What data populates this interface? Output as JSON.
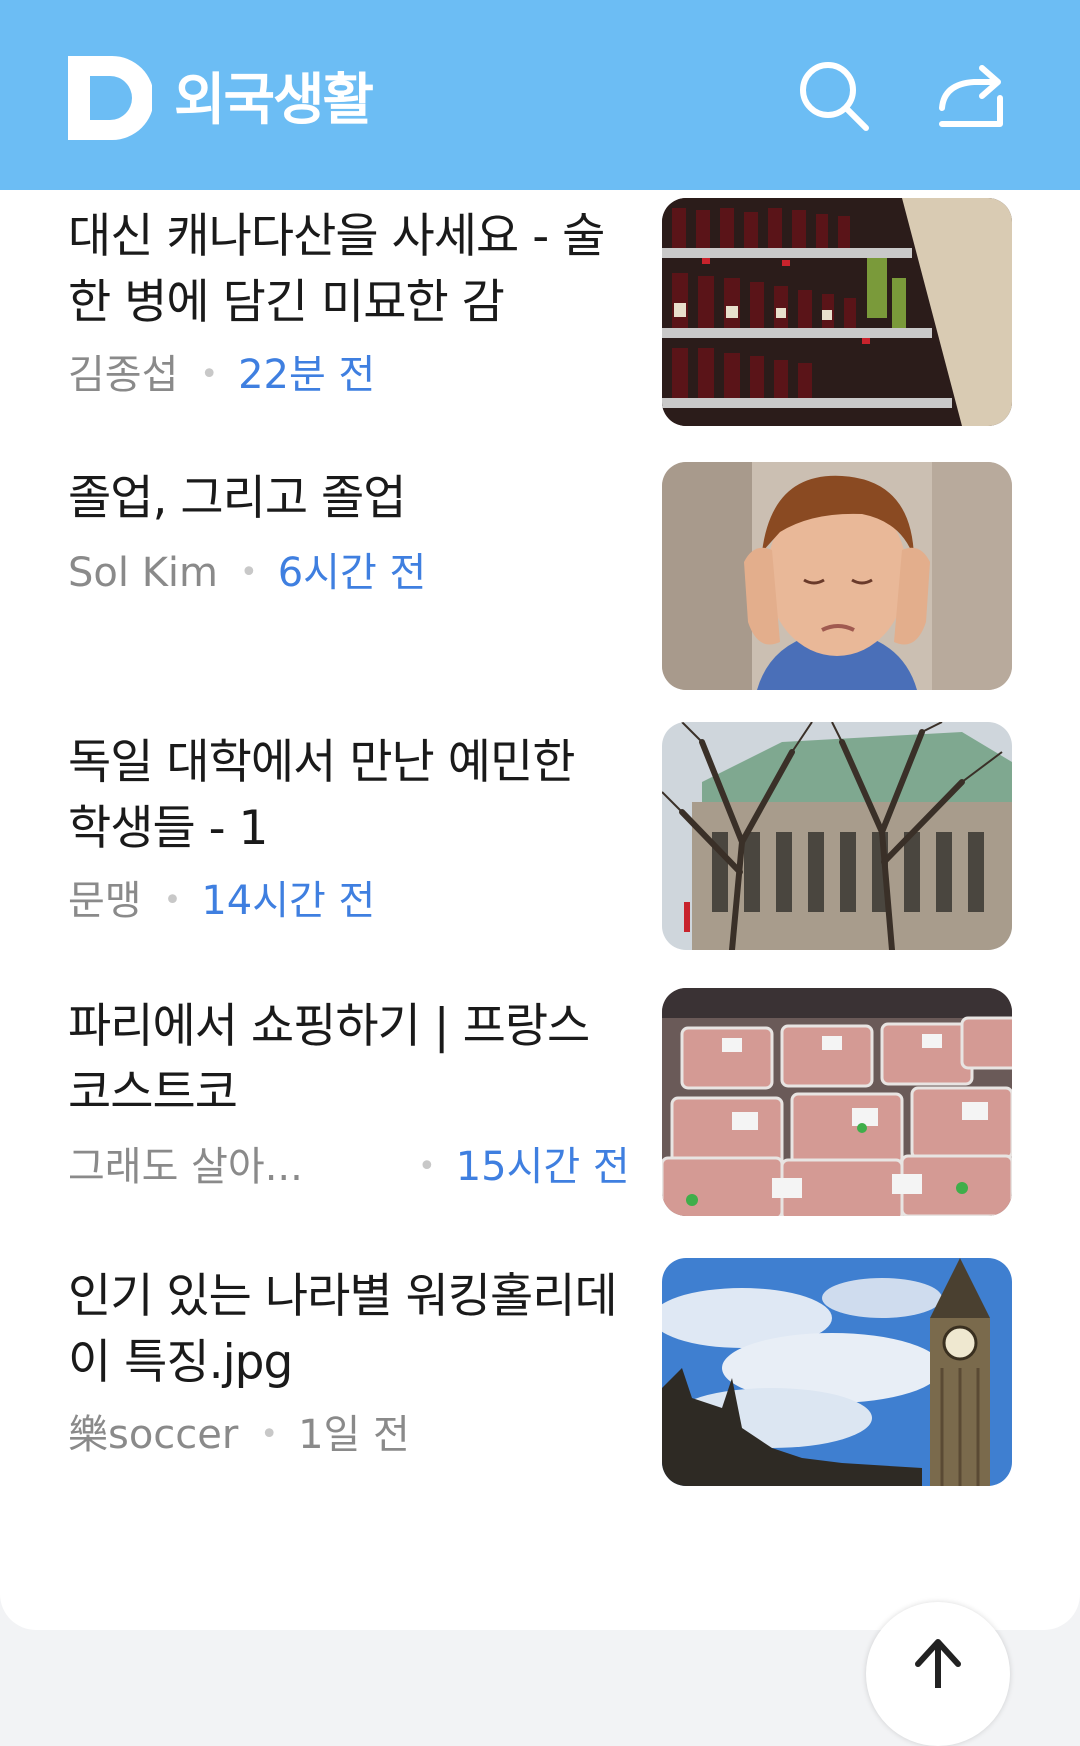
{
  "header": {
    "logo_letter": "D",
    "title": "외국생활",
    "search_icon": "search-icon",
    "share_icon": "share-icon",
    "background_color": "#6cbdf4"
  },
  "articles": [
    {
      "title": "대신 캐나다산을 사세요 - 술 한 병에 담긴 미묘한 감",
      "author": "김종섭",
      "time": "22분 전",
      "thumbnail": "wine-shelves-photo"
    },
    {
      "title": "졸업, 그리고 졸업",
      "author": "Sol Kim",
      "time": "6시간 전",
      "thumbnail": "boy-covering-ears-photo"
    },
    {
      "title": "독일 대학에서 만난 예민한 학생들 - 1",
      "author": "문맹",
      "time": "14시간 전",
      "thumbnail": "university-building-trees-photo"
    },
    {
      "title": "파리에서 쇼핑하기 | 프랑스 코스트코",
      "author": "그래도 살아...",
      "time": "15시간 전",
      "thumbnail": "meat-packages-photo"
    },
    {
      "title": "인기 있는 나라별 워킹홀리데이 특징.jpg",
      "author": "樂soccer",
      "time": "1일 전",
      "thumbnail": "big-ben-photo"
    }
  ],
  "scroll_top_icon": "arrow-up-icon",
  "colors": {
    "time_accent": "#3f7fe0",
    "meta_gray": "#8a8a8a"
  }
}
